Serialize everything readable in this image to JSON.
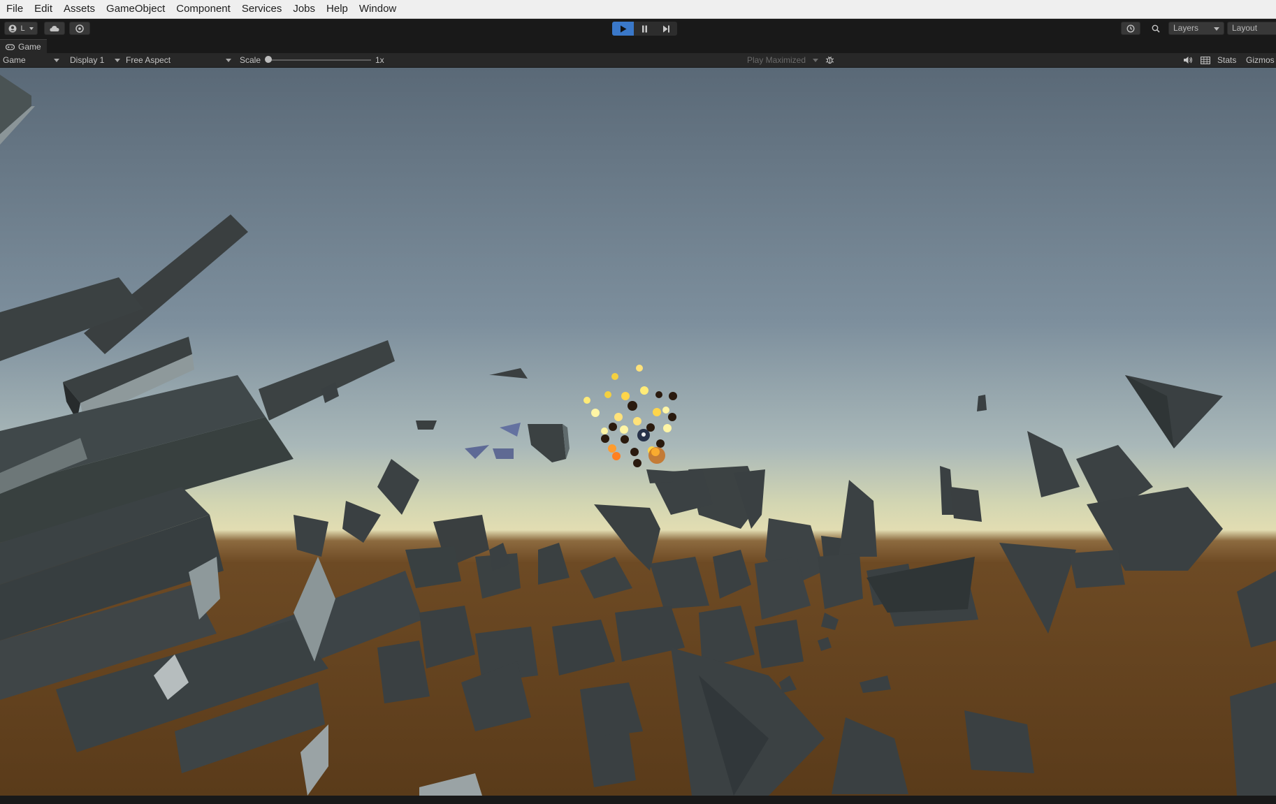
{
  "menu": [
    "File",
    "Edit",
    "Assets",
    "GameObject",
    "Component",
    "Services",
    "Jobs",
    "Help",
    "Window"
  ],
  "toolbar": {
    "account_label": "L",
    "layers_label": "Layers",
    "layout_label": "Layout"
  },
  "game_tab": {
    "label": "Game"
  },
  "game_controls": {
    "view_select": "Game",
    "display_select": "Display 1",
    "aspect_select": "Free Aspect",
    "scale_label": "Scale",
    "scale_value": "1x",
    "play_mode_select": "Play Maximized",
    "stats_label": "Stats",
    "gizmos_label": "Gizmos"
  },
  "colors": {
    "menubar_bg": "#efefef",
    "toolbar_bg": "#191919",
    "play_active": "#3a78c9",
    "sky_top": "#5b6b79",
    "sky_horizon": "#dcdcb0",
    "ground": "#6a4620",
    "rock": "#3f4546"
  },
  "icons": [
    "account-icon",
    "cloud-icon",
    "collab-icon",
    "play-icon",
    "pause-icon",
    "step-icon",
    "history-icon",
    "search-icon",
    "gamepad-icon",
    "bug-icon",
    "audio-icon",
    "layout-grid-icon"
  ]
}
